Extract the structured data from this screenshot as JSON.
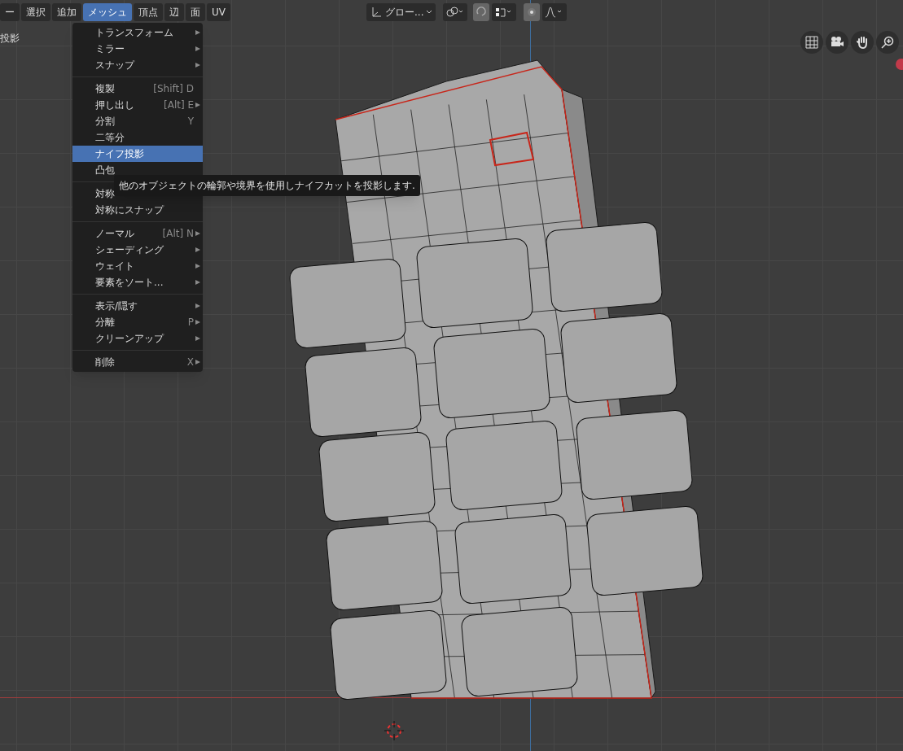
{
  "header": {
    "menus": [
      {
        "label": "ー",
        "selected": false
      },
      {
        "label": "選択",
        "selected": false
      },
      {
        "label": "追加",
        "selected": false
      },
      {
        "label": "メッシュ",
        "selected": true
      },
      {
        "label": "頂点",
        "selected": false
      },
      {
        "label": "辺",
        "selected": false
      },
      {
        "label": "面",
        "selected": false
      },
      {
        "label": "UV",
        "selected": false
      }
    ],
    "transform_orientation": "グロー...",
    "snap_on": true,
    "proportional_on": true
  },
  "operator_label": "投影",
  "menu": {
    "sections": [
      [
        {
          "label": "トランスフォーム",
          "submenu": true,
          "selected": false
        },
        {
          "label": "ミラー",
          "submenu": true,
          "selected": false
        },
        {
          "label": "スナップ",
          "submenu": true,
          "selected": false
        }
      ],
      [
        {
          "label": "複製",
          "shortcut": "[Shift] D",
          "submenu": false,
          "selected": false
        },
        {
          "label": "押し出し",
          "shortcut": "[Alt] E",
          "submenu": true,
          "selected": false
        },
        {
          "label": "分割",
          "shortcut": "Y",
          "submenu": false,
          "selected": false
        },
        {
          "label": "二等分",
          "submenu": false,
          "selected": false
        },
        {
          "label": "ナイフ投影",
          "submenu": false,
          "selected": true
        },
        {
          "label": "凸包",
          "submenu": false,
          "selected": false
        }
      ],
      [
        {
          "label": "対称",
          "selected": false
        },
        {
          "label": "対称にスナップ",
          "submenu": false,
          "selected": false
        }
      ],
      [
        {
          "label": "ノーマル",
          "shortcut": "[Alt] N",
          "submenu": true,
          "selected": false
        },
        {
          "label": "シェーディング",
          "submenu": true,
          "selected": false
        },
        {
          "label": "ウェイト",
          "submenu": true,
          "selected": false
        },
        {
          "label": "要素をソート...",
          "submenu": true,
          "selected": false
        }
      ],
      [
        {
          "label": "表示/隠す",
          "submenu": true,
          "selected": false
        },
        {
          "label": "分離",
          "shortcut": "P",
          "submenu": true,
          "selected": false
        },
        {
          "label": "クリーンアップ",
          "submenu": true,
          "selected": false
        }
      ],
      [
        {
          "label": "削除",
          "shortcut": "X",
          "submenu": true,
          "selected": false
        }
      ]
    ]
  },
  "tooltip": {
    "text": "他のオブジェクトの輪郭や境界を使用しナイフカットを投影します."
  }
}
